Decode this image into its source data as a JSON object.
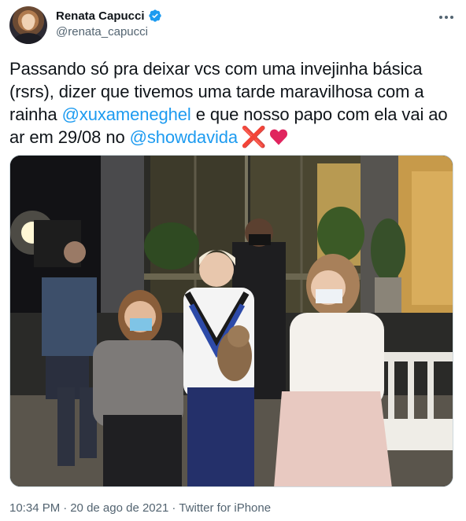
{
  "author": {
    "display_name": "Renata Capucci",
    "handle": "@renata_capucci",
    "verified": true
  },
  "tweet": {
    "text_part1": "Passando só pra deixar vcs com uma invejinha básica (rsrs), dizer que tivemos uma tarde maravilhosa com a rainha ",
    "mention1": "@xuxameneghel",
    "text_part2": " e que nosso papo com ela vai ao ar em 29/08 no ",
    "mention2": "@showdavida",
    "emoji_cross": "❌",
    "emoji_heart": "heart-emoji"
  },
  "meta": {
    "time": "10:34 PM",
    "separator": "·",
    "date": "20 de ago de 2021",
    "source": "Twitter for iPhone"
  },
  "colors": {
    "link": "#1d9bf0",
    "secondary_text": "#536471",
    "verified": "#1d9bf0",
    "heart": "#e0245e"
  }
}
